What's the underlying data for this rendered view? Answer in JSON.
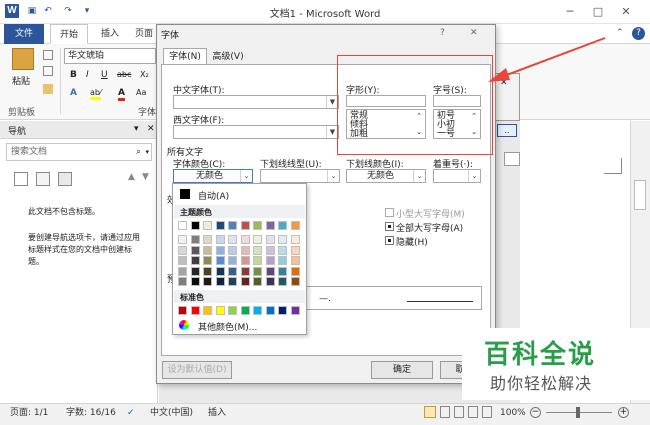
{
  "window": {
    "title": "文档1 - Microsoft Word",
    "min": "─",
    "max": "□",
    "close": "✕"
  },
  "qat": {
    "save": "▣",
    "undo": "↶",
    "redo": "↷",
    "customize": "▾"
  },
  "ribbon": {
    "tabs": [
      "文件",
      "开始",
      "插入",
      "页面"
    ],
    "paste_label": "粘贴",
    "font_name": "华文琥珀",
    "clipboard_group": "剪贴板",
    "font_group_hint": "字体",
    "format_buttons": [
      "B",
      "I",
      "U",
      "abc",
      "X₂"
    ],
    "color_buttons": [
      "A",
      "ab⁄",
      "A",
      "Aa"
    ]
  },
  "nav": {
    "title": "导航",
    "search_placeholder": "搜索文档",
    "empty_line1": "此文档不包含标题。",
    "empty_line2": "要创建导航选项卡，请通过应用标题样式在您的文档中创建标题。"
  },
  "dialog": {
    "title": "字体",
    "help": "?",
    "close": "✕",
    "tabs": [
      "字体(N)",
      "高级(V)"
    ],
    "chinese_font_label": "中文字体(T):",
    "western_font_label": "西文字体(F):",
    "style_label": "字形(Y):",
    "size_label": "字号(S):",
    "style_options": [
      "常规",
      "倾斜",
      "加粗"
    ],
    "size_options": [
      "初号",
      "小初",
      "一号"
    ],
    "all_text_label": "所有文字",
    "font_color_label": "字体颜色(C):",
    "font_color_value": "无颜色",
    "underline_type_label": "下划线线型(U):",
    "underline_color_label": "下划线颜色(I):",
    "underline_color_value": "无颜色",
    "emphasis_label": "着重号(·):",
    "effects_label": "效",
    "small_caps": "小型大写字母(M)",
    "all_caps": "全部大写字母(A)",
    "hidden": "隐藏(H)",
    "preview_label": "预",
    "preview_text": "—.",
    "set_default": "设为默认值(D)",
    "ok": "确定",
    "cancel": "取"
  },
  "palette": {
    "auto": "自动(A)",
    "theme_title": "主题颜色",
    "standard_title": "标准色",
    "more": "其他颜色(M)...",
    "theme_top": [
      "#ffffff",
      "#000000",
      "#eeece1",
      "#1f497d",
      "#4f81bd",
      "#c0504d",
      "#9bbb59",
      "#8064a2",
      "#4bacc6",
      "#f79646"
    ],
    "theme_shades": [
      [
        "#f2f2f2",
        "#7f7f7f",
        "#ddd9c3",
        "#c6d9f0",
        "#dbe5f1",
        "#f2dcdb",
        "#ebf1dd",
        "#e5e0ec",
        "#dbeef3",
        "#fdeada"
      ],
      [
        "#d8d8d8",
        "#595959",
        "#c4bd97",
        "#8db3e2",
        "#b8cce4",
        "#e5b9b7",
        "#d7e3bc",
        "#ccc1d9",
        "#b7dde8",
        "#fbd5b5"
      ],
      [
        "#bfbfbf",
        "#3f3f3f",
        "#938953",
        "#548dd4",
        "#95b3d7",
        "#d99694",
        "#c3d69b",
        "#b2a2c7",
        "#92cddc",
        "#fac08f"
      ],
      [
        "#a5a5a5",
        "#262626",
        "#494429",
        "#17365d",
        "#366092",
        "#953734",
        "#76923c",
        "#5f497a",
        "#31859b",
        "#e36c09"
      ],
      [
        "#7f7f7f",
        "#0c0c0c",
        "#1d1b10",
        "#0f243e",
        "#244061",
        "#632423",
        "#4f6128",
        "#3f3151",
        "#205867",
        "#974806"
      ]
    ],
    "standard": [
      "#c00000",
      "#ff0000",
      "#ffc000",
      "#ffff00",
      "#92d050",
      "#00b050",
      "#00b0f0",
      "#0070c0",
      "#002060",
      "#7030a0"
    ]
  },
  "status": {
    "page": "页面: 1/1",
    "words": "字数: 16/16",
    "lang": "中文(中国)",
    "mode": "插入",
    "zoom": "100%"
  },
  "watermark": {
    "line1": "百科全说",
    "line2": "助你轻松解决"
  },
  "colors": {
    "accent": "#2b579a",
    "highlight": "#e8453c",
    "watermark": "#2a9d4a"
  }
}
